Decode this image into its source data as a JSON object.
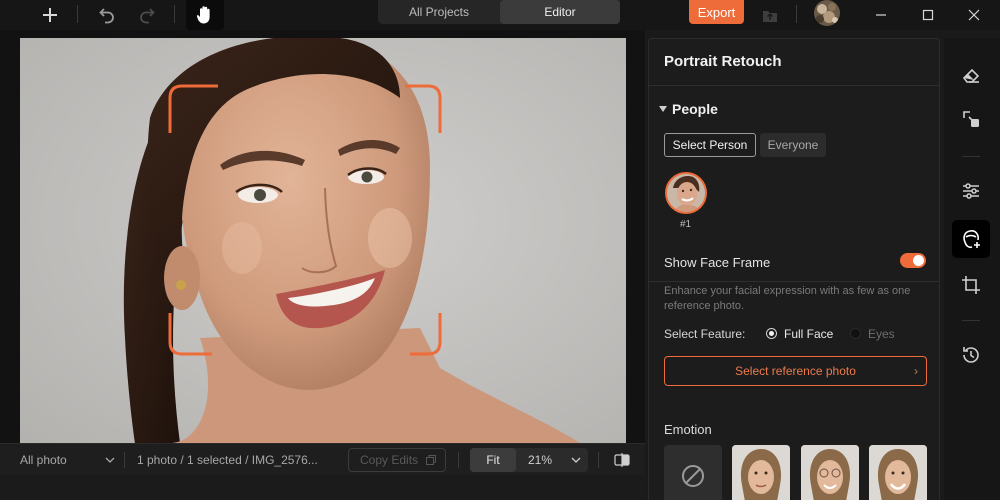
{
  "topbar": {
    "tabs": [
      {
        "label": "All Projects",
        "active": false
      },
      {
        "label": "Editor",
        "active": true
      }
    ],
    "export_label": "Export"
  },
  "bottombar": {
    "filter_label": "All photo",
    "status_text": "1 photo / 1 selected / IMG_2576...",
    "copy_edits_label": "Copy Edits",
    "fit_label": "Fit",
    "zoom_value": "21%"
  },
  "panel": {
    "title": "Portrait Retouch",
    "people": {
      "heading": "People",
      "select_person_label": "Select Person",
      "everyone_label": "Everyone",
      "person_number": "#1"
    },
    "show_face_frame": {
      "label": "Show Face Frame",
      "enabled": true
    },
    "description": "Enhance your facial expression with as few as one reference photo.",
    "select_feature": {
      "label": "Select Feature:",
      "options": [
        {
          "label": "Full Face",
          "selected": true
        },
        {
          "label": "Eyes",
          "selected": false
        }
      ]
    },
    "reference_button_label": "Select reference photo",
    "emotion": {
      "label": "Emotion"
    }
  },
  "right_toolbar": {
    "icons": [
      "eraser-icon",
      "object-removal-icon",
      "adjustments-icon",
      "portrait-retouch-icon",
      "crop-icon",
      "history-icon"
    ],
    "active": "portrait-retouch-icon"
  },
  "colors": {
    "accent": "#ee6b3a",
    "panel_bg": "#1c1c1c",
    "app_bg": "#161616"
  }
}
